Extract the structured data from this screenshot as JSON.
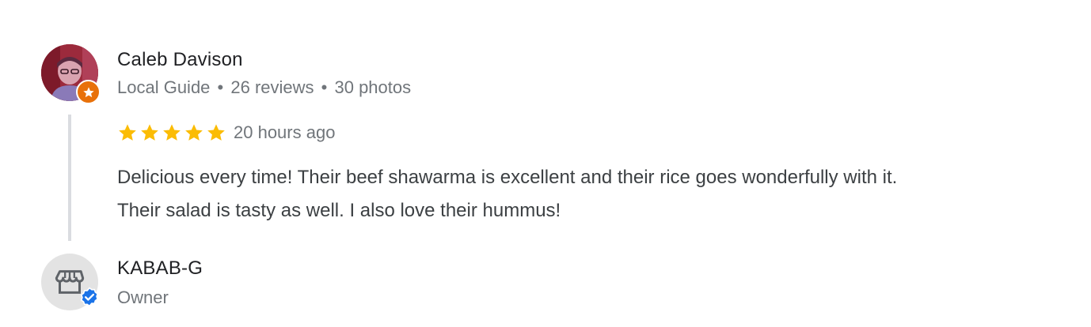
{
  "review": {
    "reviewer_name": "Caleb Davison",
    "reviewer_badge": "Local Guide",
    "review_count": "26 reviews",
    "photo_count": "30 photos",
    "separator": "•",
    "rating": 5,
    "rating_max": 5,
    "time_ago": "20 hours ago",
    "text_line_1": "Delicious every time! Their beef shawarma is excellent and their rice goes wonderfully with it.",
    "text_line_2": "Their salad is tasty as well. I also love their hummus!"
  },
  "owner_reply": {
    "name": "KABAB-G",
    "role": "Owner"
  },
  "icons": {
    "guide_badge": "star-badge-icon",
    "verified": "verified-check-icon",
    "store": "storefront-icon",
    "rating_star": "star-icon"
  },
  "colors": {
    "star": "#fbbc04",
    "guide_badge": "#e8710a",
    "verified": "#1a73e8",
    "meta_text": "#70757a",
    "thread_line": "#dadce0"
  }
}
